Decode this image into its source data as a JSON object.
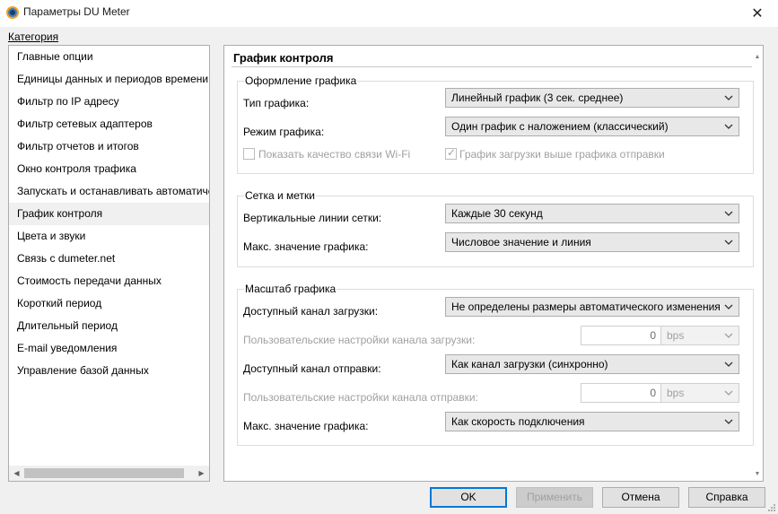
{
  "window": {
    "title": "Параметры DU Meter",
    "close_glyph": "✕"
  },
  "category_label": "Категория",
  "sidebar": {
    "items": [
      {
        "label": "Главные опции"
      },
      {
        "label": "Единицы данных и периодов времени"
      },
      {
        "label": "Фильтр по IP адресу"
      },
      {
        "label": "Фильтр сетевых адаптеров"
      },
      {
        "label": "Фильтр отчетов и итогов"
      },
      {
        "label": "Окно контроля трафика"
      },
      {
        "label": "Запускать и останавливать автоматически"
      },
      {
        "label": "График контроля",
        "selected": true
      },
      {
        "label": "Цвета и звуки"
      },
      {
        "label": "Связь с dumeter.net"
      },
      {
        "label": "Стоимость передачи данных"
      },
      {
        "label": "Короткий период"
      },
      {
        "label": "Длительный период"
      },
      {
        "label": "E-mail уведомления"
      },
      {
        "label": "Управление базой данных"
      }
    ]
  },
  "panel": {
    "title": "График контроля",
    "appearance": {
      "title": "Оформление графика",
      "chart_type_label": "Тип графика:",
      "chart_type_value": "Линейный график (3 сек. среднее)",
      "chart_mode_label": "Режим графика:",
      "chart_mode_value": "Один график с наложением (классический)",
      "wifi_quality_label": "Показать качество связи Wi-Fi",
      "download_above_label": "График загрузки выше графика отправки"
    },
    "grid": {
      "title": "Сетка и метки",
      "vertical_lines_label": "Вертикальные линии сетки:",
      "vertical_lines_value": "Каждые 30 секунд",
      "max_value_label": "Макс. значение графика:",
      "max_value_value": "Числовое значение и линия"
    },
    "scale": {
      "title": "Масштаб графика",
      "download_channel_label": "Доступный канал загрузки:",
      "download_channel_value": "Не определены размеры автоматического изменения р",
      "custom_download_label": "Пользовательские настройки канала загрузки:",
      "custom_download_value": "0",
      "custom_download_unit": "bps",
      "upload_channel_label": "Доступный канал отправки:",
      "upload_channel_value": "Как канал загрузки (синхронно)",
      "custom_upload_label": "Пользовательские настройки канала отправки:",
      "custom_upload_value": "0",
      "custom_upload_unit": "bps",
      "max_chart_label": "Макс. значение графика:",
      "max_chart_value": "Как скорость подключения"
    }
  },
  "buttons": {
    "ok": "OK",
    "apply": "Применить",
    "cancel": "Отмена",
    "help": "Справка"
  },
  "colors": {
    "accent": "#0078d7",
    "disabled_text": "#a0a0a0"
  }
}
